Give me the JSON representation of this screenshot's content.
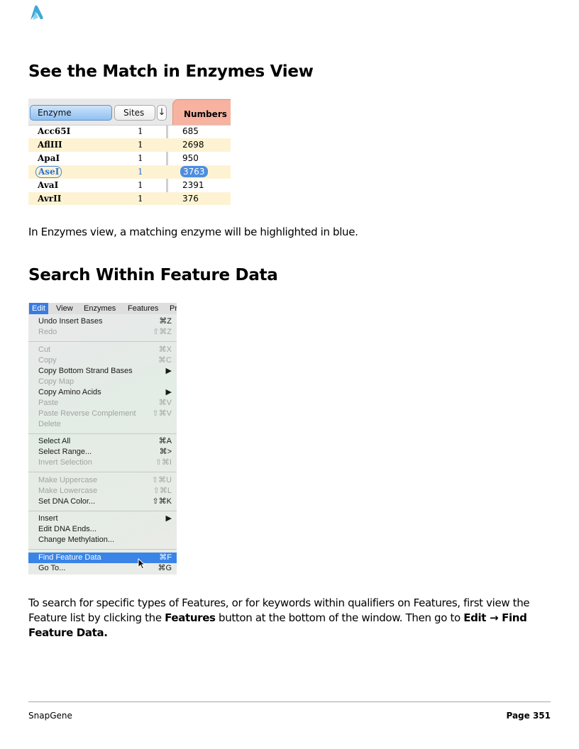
{
  "brand_colors": {
    "logo": "#3fa9d6",
    "selection_blue": "#3a84e8",
    "numbers_tab": "#f7b3a0"
  },
  "sections": {
    "match": {
      "title": "See the Match in Enzymes View",
      "description": "In Enzymes view, a matching enzyme will be highlighted in blue."
    },
    "search": {
      "title": "Search Within Feature Data",
      "description_parts": [
        "To search for specific types of Features, or for keywords within qualifiers on Features, first view the Feature list by clicking the ",
        "Features",
        " button at the bottom of the window.  Then go to ",
        "Edit → Find Feature Data."
      ]
    }
  },
  "enzymes_table": {
    "headers": {
      "enzyme": "Enzyme",
      "sites": "Sites",
      "sort": "↓",
      "numbers": "Numbers"
    },
    "rows": [
      {
        "name": "Acc65I",
        "sites": "1",
        "number": "685"
      },
      {
        "name": "AflIII",
        "sites": "1",
        "number": "2698"
      },
      {
        "name": "ApaI",
        "sites": "1",
        "number": "950"
      },
      {
        "name": "AseI",
        "sites": "1",
        "number": "3763",
        "highlighted": true
      },
      {
        "name": "AvaI",
        "sites": "1",
        "number": "2391"
      },
      {
        "name": "AvrII",
        "sites": "1",
        "number": "376"
      }
    ]
  },
  "edit_menu": {
    "menubar": [
      "Edit",
      "View",
      "Enzymes",
      "Features",
      "Pr"
    ],
    "items": [
      {
        "label": "Undo Insert Bases",
        "shortcut": "⌘Z"
      },
      {
        "label": "Redo",
        "shortcut": "⇧⌘Z",
        "disabled": true
      },
      {
        "label": "Cut",
        "shortcut": "⌘X",
        "disabled": true
      },
      {
        "label": "Copy",
        "shortcut": "⌘C",
        "disabled": true
      },
      {
        "label": "Copy Bottom Strand Bases",
        "shortcut": "▶"
      },
      {
        "label": "Copy Map",
        "shortcut": "",
        "disabled": true
      },
      {
        "label": "Copy Amino Acids",
        "shortcut": "▶"
      },
      {
        "label": "Paste",
        "shortcut": "⌘V",
        "disabled": true
      },
      {
        "label": "Paste Reverse Complement",
        "shortcut": "⇧⌘V",
        "disabled": true
      },
      {
        "label": "Delete",
        "shortcut": "",
        "disabled": true
      },
      {
        "label": "Select All",
        "shortcut": "⌘A"
      },
      {
        "label": "Select Range...",
        "shortcut": "⌘>"
      },
      {
        "label": "Invert Selection",
        "shortcut": "⇧⌘I",
        "disabled": true
      },
      {
        "label": "Make Uppercase",
        "shortcut": "⇧⌘U",
        "disabled": true
      },
      {
        "label": "Make Lowercase",
        "shortcut": "⇧⌘L",
        "disabled": true
      },
      {
        "label": "Set DNA Color...",
        "shortcut": "⇧⌘K"
      },
      {
        "label": "Insert",
        "shortcut": "▶"
      },
      {
        "label": "Edit DNA Ends...",
        "shortcut": ""
      },
      {
        "label": "Change Methylation...",
        "shortcut": ""
      },
      {
        "label": "Find Feature Data",
        "shortcut": "⌘F",
        "selected": true
      },
      {
        "label": "Go To...",
        "shortcut": "⌘G"
      }
    ]
  },
  "footer": {
    "left": "SnapGene",
    "right": "Page 351"
  }
}
